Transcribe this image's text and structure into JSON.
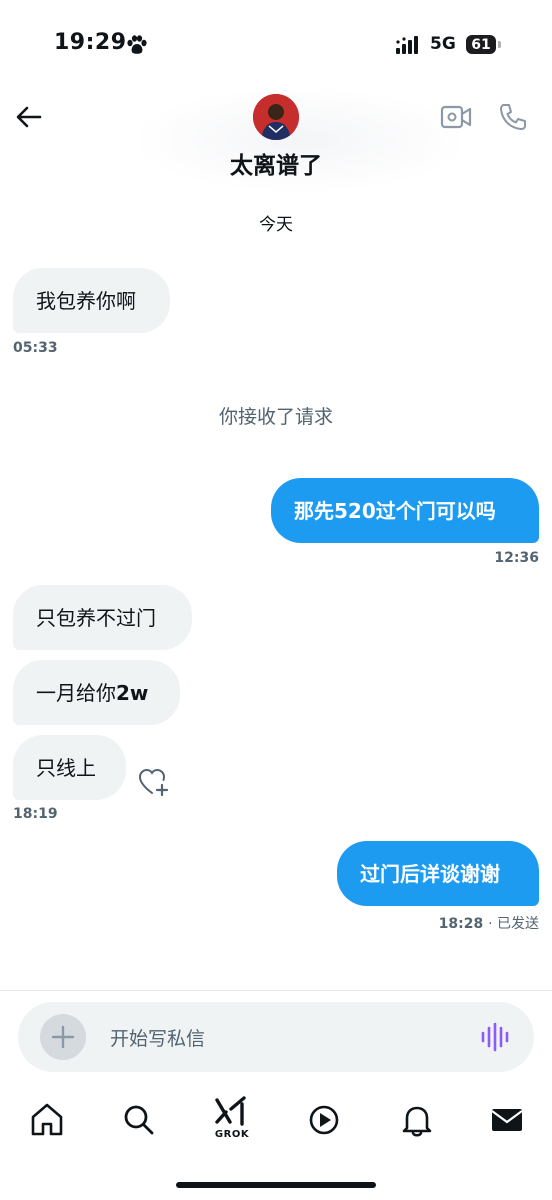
{
  "status_bar": {
    "time": "19:29",
    "network": "5G",
    "battery": "61"
  },
  "header": {
    "contact_name": "太离谱了"
  },
  "chat": {
    "date_divider": "今天",
    "system_notice": "你接收了请求",
    "messages": [
      {
        "direction": "incoming",
        "text": "我包养你啊",
        "time": "05:33"
      },
      {
        "direction": "outgoing",
        "text_prefix": "那先",
        "text_bold": "520",
        "text_suffix": "过个门可以吗",
        "time": "12:36"
      },
      {
        "direction": "incoming",
        "text": "只包养不过门"
      },
      {
        "direction": "incoming",
        "text_prefix": "一月给你",
        "text_bold": "2w"
      },
      {
        "direction": "incoming",
        "text": "只线上",
        "time": "18:19"
      },
      {
        "direction": "outgoing",
        "text": "过门后详谈谢谢",
        "time": "18:28",
        "status": "· 已发送"
      }
    ]
  },
  "composer": {
    "placeholder": "开始写私信"
  },
  "bottom_nav": {
    "grok_label": "GROK",
    "items": [
      "home-icon",
      "search-icon",
      "grok-icon",
      "video-icon",
      "notifications-icon",
      "messages-icon"
    ]
  },
  "colors": {
    "accent": "#1d9bf0",
    "bubble_incoming": "#eff3f4",
    "secondary_text": "#536471",
    "voice_icon": "#8b5cf6"
  }
}
